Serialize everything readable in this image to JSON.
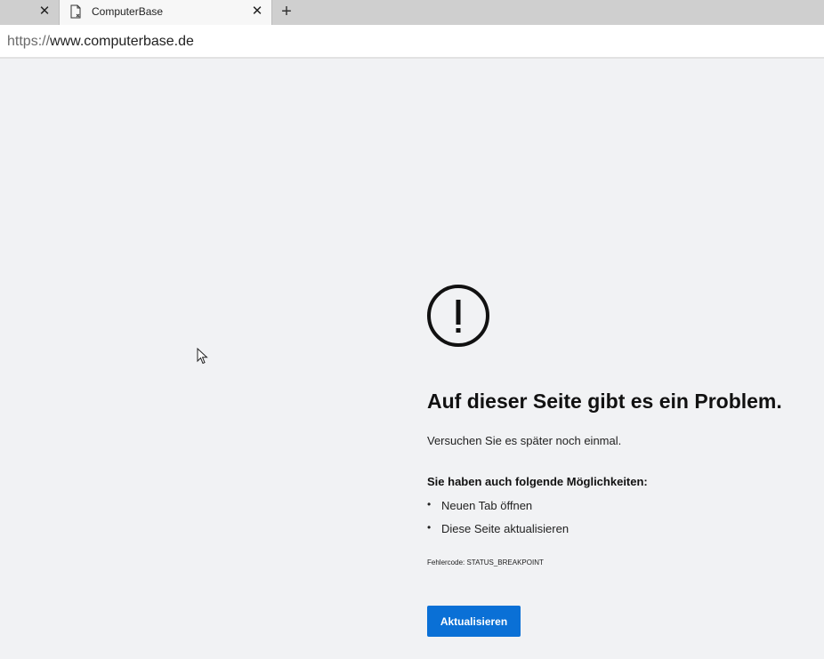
{
  "browser": {
    "tabs": [
      {
        "title": "",
        "close_icon": "close-icon"
      },
      {
        "title": "ComputerBase",
        "favicon": "document-error-icon",
        "close_icon": "close-icon"
      }
    ],
    "new_tab_icon": "plus-icon",
    "url": {
      "scheme": "https://",
      "host": "www.computerbase.de"
    }
  },
  "error_page": {
    "icon": "exclamation-circle-icon",
    "heading": "Auf dieser Seite gibt es ein Problem.",
    "subtext": "Versuchen Sie es später noch einmal.",
    "options_heading": "Sie haben auch folgende Möglichkeiten:",
    "options": [
      "Neuen Tab öffnen",
      "Diese Seite aktualisieren"
    ],
    "error_code": "Fehlercode: STATUS_BREAKPOINT",
    "refresh_button_label": "Aktualisieren"
  },
  "colors": {
    "page_background": "#f1f2f4",
    "tabstrip": "#cfcfcf",
    "accent": "#0a70d6"
  }
}
